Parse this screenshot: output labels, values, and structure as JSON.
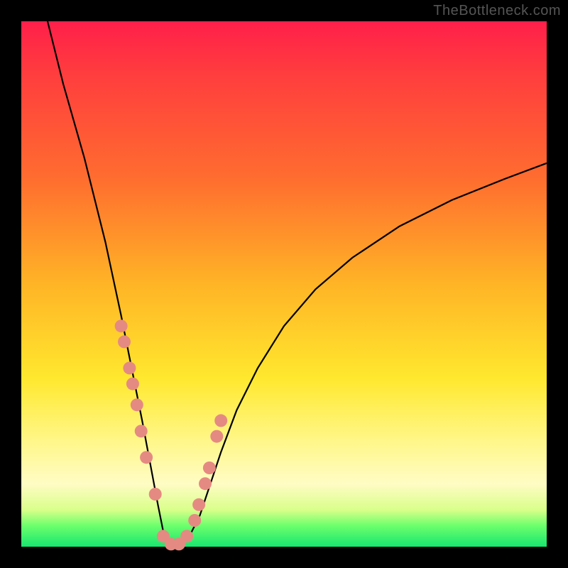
{
  "watermark": "TheBottleneck.com",
  "chart_data": {
    "type": "line",
    "title": "",
    "xlabel": "",
    "ylabel": "",
    "xlim": [
      0,
      100
    ],
    "ylim": [
      0,
      100
    ],
    "background_gradient": {
      "orientation": "vertical",
      "stops": [
        {
          "pct": 0,
          "color": "#ff1f4a"
        },
        {
          "pct": 30,
          "color": "#ff6d2f"
        },
        {
          "pct": 50,
          "color": "#ffb426"
        },
        {
          "pct": 70,
          "color": "#ffe82e"
        },
        {
          "pct": 90,
          "color": "#fffcc4"
        },
        {
          "pct": 100,
          "color": "#17e66f"
        }
      ]
    },
    "series": [
      {
        "name": "bottleneck-curve",
        "x": [
          5,
          8,
          12,
          16,
          19,
          21,
          23,
          24.5,
          26,
          27,
          28,
          30,
          32,
          34,
          36,
          38,
          41,
          45,
          50,
          56,
          63,
          72,
          82,
          92,
          100
        ],
        "y": [
          100,
          88,
          74,
          58,
          44,
          34,
          24,
          16,
          8,
          3,
          0,
          0,
          2,
          6,
          12,
          18,
          26,
          34,
          42,
          49,
          55,
          61,
          66,
          70,
          73
        ]
      }
    ],
    "marker_points": {
      "name": "highlighted-points",
      "color": "#e58a82",
      "x": [
        19.0,
        19.6,
        20.6,
        21.2,
        22.0,
        22.8,
        23.8,
        25.5,
        27.0,
        28.5,
        30.0,
        31.5,
        33.0,
        33.8,
        35.0,
        35.8,
        37.2,
        38.0
      ],
      "y": [
        42.0,
        39.0,
        34.0,
        31.0,
        27.0,
        22.0,
        17.0,
        10.0,
        2.0,
        0.5,
        0.5,
        2.0,
        5.0,
        8.0,
        12.0,
        15.0,
        21.0,
        24.0
      ]
    }
  }
}
